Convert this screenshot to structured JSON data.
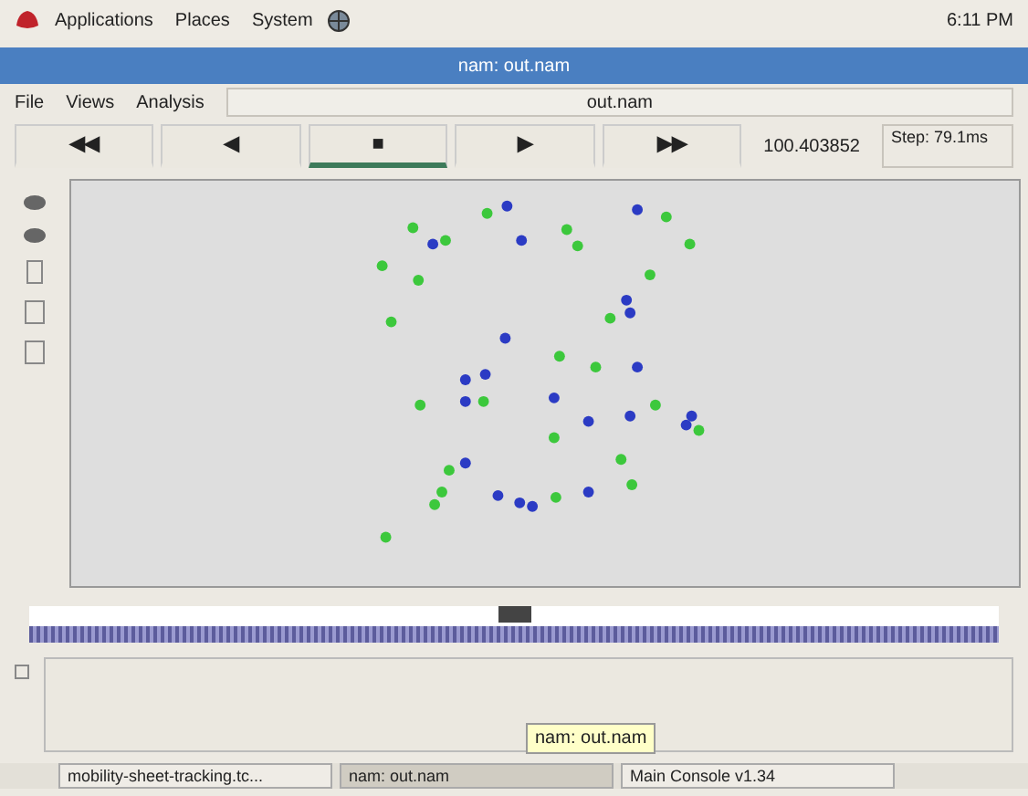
{
  "top_panel": {
    "menus": [
      "Applications",
      "Places",
      "System"
    ],
    "clock": "6:11 PM"
  },
  "window": {
    "title": "nam: out.nam"
  },
  "menu": [
    "File",
    "Views",
    "Analysis"
  ],
  "file_label": "out.nam",
  "controls": [
    {
      "label": "◀◀",
      "selected": false
    },
    {
      "label": "◀",
      "selected": false
    },
    {
      "label": "■",
      "selected": true
    },
    {
      "label": "▶",
      "selected": false
    },
    {
      "label": "▶▶",
      "selected": false
    }
  ],
  "time": "100.403852",
  "step": "Step: 79.1ms",
  "nodes": [
    {
      "color": "#2b3bc4"
    },
    {
      "color": "#2b3bc4"
    },
    {
      "color": "#2b3bc4"
    },
    {
      "color": "#2b3bc4"
    },
    {
      "color": "#2b3bc4"
    },
    {
      "color": "#2b3bc4"
    },
    {
      "color": "#2b3bc4"
    },
    {
      "color": "#2b3bc4"
    },
    {
      "color": "#2b3bc4"
    },
    {
      "color": "#2b3bc4"
    },
    {
      "color": "#2b3bc4"
    },
    {
      "color": "#2b3bc4"
    },
    {
      "color": "#2b3bc4"
    },
    {
      "color": "#2b3bc4"
    },
    {
      "color": "#2b3bc4"
    },
    {
      "color": "#2b3bc4"
    },
    {
      "color": "#2b3bc4"
    },
    {
      "color": "#2b3bc4"
    },
    {
      "color": "#2b3bc4"
    },
    {
      "color": "#2b3bc4"
    },
    {
      "color": "#2b3bc4"
    },
    {
      "color": "#3cc83c"
    },
    {
      "color": "#3cc83c"
    },
    {
      "color": "#3cc83c"
    },
    {
      "color": "#3cc83c"
    },
    {
      "color": "#3cc83c"
    },
    {
      "color": "#3cc83c"
    },
    {
      "color": "#3cc83c"
    },
    {
      "color": "#3cc83c"
    },
    {
      "color": "#3cc83c"
    },
    {
      "color": "#3cc83c"
    },
    {
      "color": "#3cc83c"
    },
    {
      "color": "#3cc83c"
    },
    {
      "color": "#3cc83c"
    },
    {
      "color": "#3cc83c"
    },
    {
      "color": "#3cc83c"
    },
    {
      "color": "#3cc83c"
    },
    {
      "color": "#3cc83c"
    },
    {
      "color": "#3cc83c"
    },
    {
      "color": "#3cc83c"
    },
    {
      "color": "#3cc83c"
    },
    {
      "color": "#3cc83c"
    },
    {
      "color": "#3cc83c"
    },
    {
      "color": "#3cc83c"
    },
    {
      "color": "#3cc83c"
    },
    {
      "color": "#3cc83c"
    },
    {
      "color": "#3cc83c"
    }
  ],
  "timeline": {
    "level": 0.5
  },
  "monitor_checkbox": {
    "checked": false
  },
  "tooltip": "nam: out.nam",
  "taskbar": [
    {
      "label": "mobility-sheet-tracking.tc...",
      "selected": false
    },
    {
      "label": "nam: out.nam",
      "selected": true
    },
    {
      "label": "Main Console v1.34",
      "selected": false
    }
  ]
}
